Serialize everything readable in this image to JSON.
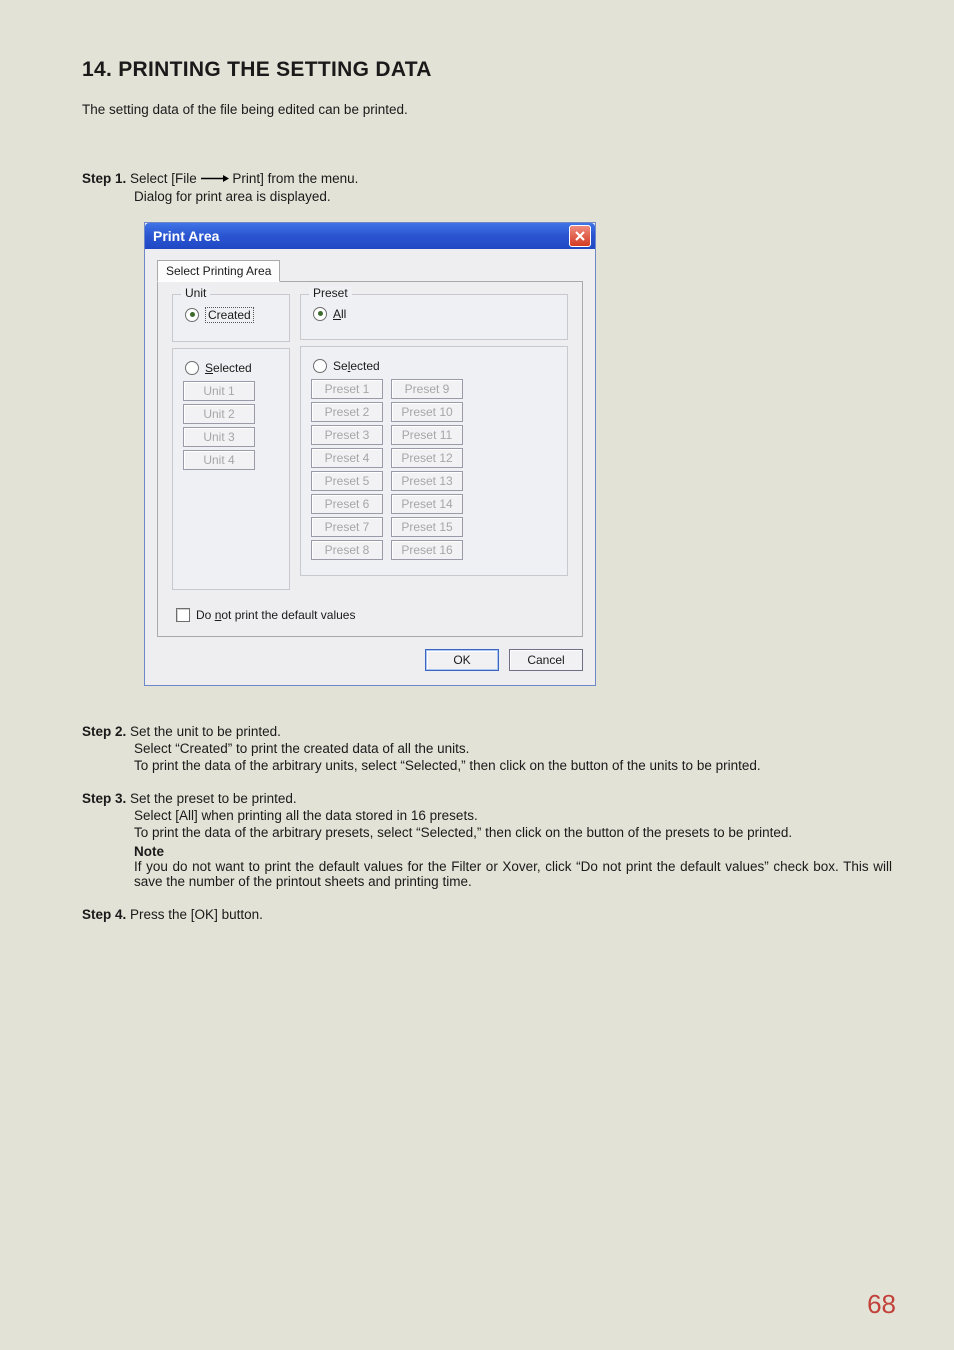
{
  "heading": "14. PRINTING THE SETTING DATA",
  "intro": "The setting data of the file being edited can be printed.",
  "step1": {
    "label": "Step 1.",
    "text": "Select [File —▸ Print] from the menu.",
    "text_prefix": "Select [File ",
    "text_suffix": " Print] from the menu.",
    "line2": "Dialog for print area is displayed."
  },
  "dialog": {
    "title": "Print Area",
    "tab": "Select Printing Area",
    "unit": {
      "legend": "Unit",
      "created": "Created",
      "selected": "Selected",
      "buttons": [
        "Unit 1",
        "Unit 2",
        "Unit 3",
        "Unit 4"
      ]
    },
    "preset": {
      "legend": "Preset",
      "all": "All",
      "selected": "Selected",
      "col1": [
        "Preset 1",
        "Preset 2",
        "Preset 3",
        "Preset 4",
        "Preset 5",
        "Preset 6",
        "Preset 7",
        "Preset 8"
      ],
      "col2": [
        "Preset 9",
        "Preset 10",
        "Preset 11",
        "Preset 12",
        "Preset 13",
        "Preset 14",
        "Preset 15",
        "Preset 16"
      ]
    },
    "checkbox_prefix": "Do ",
    "checkbox_underlined": "n",
    "checkbox_suffix": "ot print the default values",
    "ok": "OK",
    "cancel": "Cancel"
  },
  "step2": {
    "label": "Step 2.",
    "l1": "Set the unit to be printed.",
    "l2": "Select “Created” to print the created data of all the units.",
    "l3": "To print the data of the arbitrary units, select “Selected,” then click on the button of the units to be printed."
  },
  "step3": {
    "label": "Step 3.",
    "l1": "Set the preset to be printed.",
    "l2": "Select [All] when printing all the data stored in 16 presets.",
    "l3": "To print the data of the arbitrary presets, select “Selected,” then click on the button of the presets to be printed.",
    "note_label": "Note",
    "note_text": "If you do not want to print the default values for the Filter or Xover, click “Do not print the default values” check box. This will save the number of the printout sheets and printing time."
  },
  "step4": {
    "label": "Step 4.",
    "l1": "Press the [OK] button."
  },
  "page_number": "68"
}
